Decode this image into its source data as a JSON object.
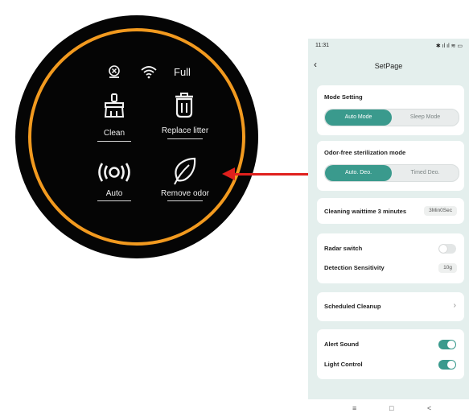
{
  "device": {
    "status_text": "Full",
    "buttons": [
      {
        "label": "Clean",
        "icon": "broom-icon"
      },
      {
        "label": "Replace litter",
        "icon": "trash-can-icon"
      },
      {
        "label": "Auto",
        "icon": "radar-icon"
      },
      {
        "label": "Remove odor",
        "icon": "leaf-icon"
      }
    ],
    "ring_color": "#f29a1f"
  },
  "arrow_color": "#e0201d",
  "phone": {
    "status_time": "11:31",
    "status_icons": "✱ ıl ıl ≋ ▭",
    "page_title": "SetPage",
    "accent_color": "#3a9a8d",
    "mode_setting": {
      "title": "Mode Setting",
      "options": [
        "Auto Mode",
        "Sleep Mode"
      ],
      "selected": "Auto Mode"
    },
    "odor_mode": {
      "title": "Odor-free sterilization mode",
      "options": [
        "Auto. Deo.",
        "Timed Deo."
      ],
      "selected": "Auto. Deo."
    },
    "cleaning_wait": {
      "label": "Cleaning waittime 3 minutes",
      "value": "3Min0Sec"
    },
    "radar": {
      "switch_label": "Radar switch",
      "switch_on": false,
      "sensitivity_label": "Detection Sensitivity",
      "sensitivity_value": "10g"
    },
    "scheduled_cleanup": {
      "label": "Scheduled Cleanup"
    },
    "alerts": {
      "alert_sound_label": "Alert Sound",
      "alert_sound_on": true,
      "light_control_label": "Light Control",
      "light_control_on": true
    },
    "system_nav": {
      "menu": "≡",
      "home": "□",
      "back": "<"
    }
  }
}
